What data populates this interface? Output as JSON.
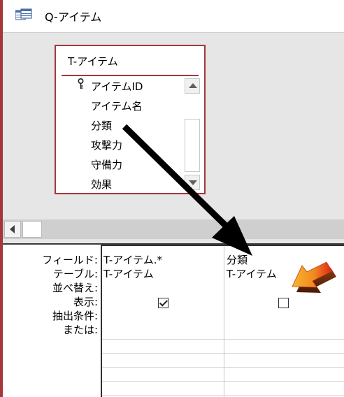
{
  "window": {
    "title": "Q-アイテム",
    "frame_color": "#a4373a"
  },
  "table_box": {
    "title": "T-アイテム",
    "fields": [
      {
        "label": "アイテムID",
        "primary_key": true
      },
      {
        "label": "アイテム名"
      },
      {
        "label": "分類"
      },
      {
        "label": "攻撃力"
      },
      {
        "label": "守備力"
      },
      {
        "label": "効果"
      }
    ]
  },
  "design_grid": {
    "row_labels": {
      "field": "フィールド:",
      "table": "テーブル:",
      "sort": "並べ替え:",
      "show": "表示:",
      "criteria": "抽出条件:",
      "or": "または:"
    },
    "columns": [
      {
        "field": "T-アイテム.*",
        "table": "T-アイテム",
        "show": true
      },
      {
        "field": "分類",
        "table": "T-アイテム",
        "show": false
      }
    ]
  },
  "icons": {
    "window_icon": "query-icon",
    "key": "primary-key-icon",
    "scroll_up": "triangle-up-icon",
    "scroll_down": "triangle-down-icon",
    "scroll_left": "triangle-left-icon",
    "annotation_black": "black-arrow-icon",
    "annotation_orange": "orange-3d-arrow-icon"
  },
  "colors": {
    "table_border": "#a4373a",
    "pane_bg": "#e6e6e6",
    "arrow_black": "#000000",
    "arrow_orange": "#f28a1e",
    "arrow_red": "#e0201a"
  }
}
